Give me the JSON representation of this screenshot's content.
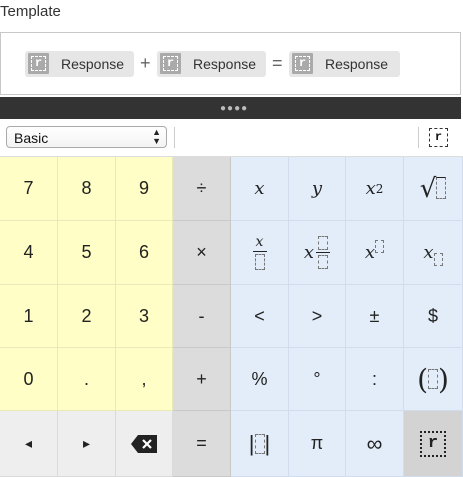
{
  "template": {
    "title": "Template",
    "tokens": [
      {
        "label": "Response",
        "icon": "r"
      },
      {
        "operator": "+"
      },
      {
        "label": "Response",
        "icon": "r"
      },
      {
        "operator": "="
      },
      {
        "label": "Response",
        "icon": "r"
      }
    ]
  },
  "toolbar": {
    "mode_select": {
      "value": "Basic"
    },
    "insert_response_icon": "r"
  },
  "keypad": {
    "numbers": [
      "7",
      "8",
      "9",
      "4",
      "5",
      "6",
      "1",
      "2",
      "3",
      "0",
      ".",
      ","
    ],
    "operators": [
      "÷",
      "×",
      "-",
      "+",
      "="
    ],
    "functions": {
      "x": "x",
      "y": "y",
      "x_squared_base": "x",
      "x_squared_exp": "2",
      "less": "<",
      "greater": ">",
      "plus_minus": "±",
      "dollar": "$",
      "percent": "%",
      "degree": "°",
      "colon": ":",
      "pi": "π",
      "infinity": "∞"
    },
    "nav": {
      "left": "◂",
      "right": "▸"
    },
    "response_key": "r"
  }
}
